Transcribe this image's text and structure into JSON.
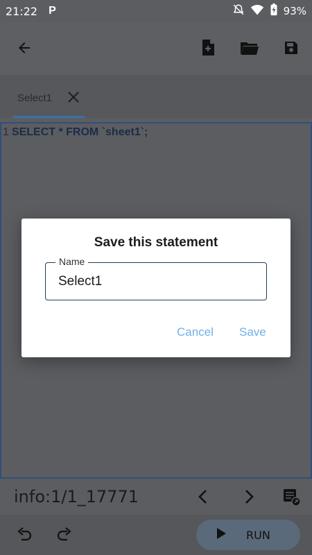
{
  "status_bar": {
    "time": "21:22",
    "app_icon_text": "P",
    "battery": "93%",
    "icons": [
      "mute-icon",
      "wifi-icon",
      "battery-charging-icon"
    ]
  },
  "app_bar": {
    "icons": [
      "back-arrow-icon",
      "new-file-icon",
      "open-folder-icon",
      "save-icon"
    ]
  },
  "tabs": [
    {
      "label": "Select1"
    }
  ],
  "editor": {
    "line_number": "1",
    "code": "SELECT * FROM `sheet1`;"
  },
  "info_bar": {
    "text": "info:1/1_17771",
    "icons": [
      "chevron-left-icon",
      "chevron-right-icon",
      "result-export-icon"
    ]
  },
  "bottom_bar": {
    "icons": [
      "undo-icon",
      "redo-icon",
      "play-icon"
    ],
    "run_label": "RUN"
  },
  "dialog": {
    "title": "Save this statement",
    "field_label": "Name",
    "field_value": "Select1",
    "cancel_label": "Cancel",
    "save_label": "Save"
  },
  "colors": {
    "scrim_bg": "#5c5d61",
    "accent_button": "#6fb0e8",
    "field_border": "#1f3b5e",
    "tab_indicator": "#3d6fa6"
  }
}
